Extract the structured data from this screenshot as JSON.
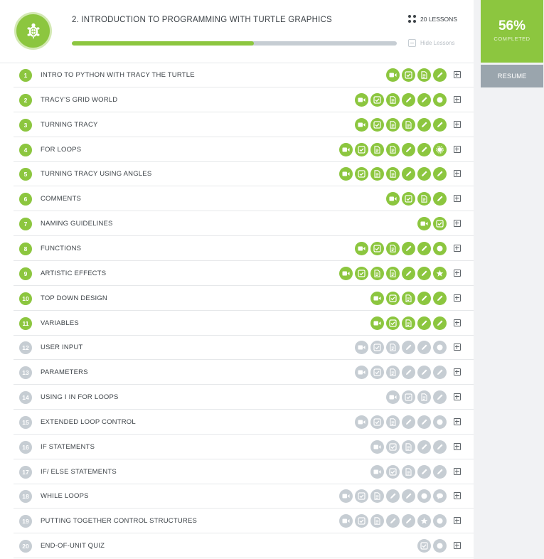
{
  "header": {
    "title": "2. INTRODUCTION TO PROGRAMMING WITH TURTLE GRAPHICS",
    "lessons_count": "20 LESSONS",
    "hide_lessons": "Hide Lessons",
    "progress_fraction": 0.56,
    "logo_icon": "turtle-icon"
  },
  "side": {
    "percent": "56%",
    "completed_label": "COMPLETED",
    "resume_label": "RESUME"
  },
  "colors": {
    "accent": "#8cc63f",
    "inactive": "#c6cdd3",
    "resume_bg": "#9aa5ad"
  },
  "lessons": [
    {
      "num": "1",
      "title": "INTRO TO PYTHON WITH TRACY THE TURTLE",
      "active": true,
      "activities": [
        "video",
        "check",
        "doc",
        "pencil"
      ]
    },
    {
      "num": "2",
      "title": "TRACY'S GRID WORLD",
      "active": true,
      "activities": [
        "video",
        "check",
        "doc",
        "pencil",
        "pencil",
        "dot"
      ]
    },
    {
      "num": "3",
      "title": "TURNING TRACY",
      "active": true,
      "activities": [
        "video",
        "check",
        "doc",
        "doc",
        "pencil",
        "pencil"
      ]
    },
    {
      "num": "4",
      "title": "FOR LOOPS",
      "active": true,
      "activities": [
        "video",
        "check",
        "doc",
        "doc",
        "pencil",
        "pencil",
        "gear"
      ]
    },
    {
      "num": "5",
      "title": "TURNING TRACY USING ANGLES",
      "active": true,
      "activities": [
        "video",
        "check",
        "doc",
        "doc",
        "pencil",
        "pencil",
        "pencil"
      ]
    },
    {
      "num": "6",
      "title": "COMMENTS",
      "active": true,
      "activities": [
        "video",
        "check",
        "doc",
        "pencil"
      ]
    },
    {
      "num": "7",
      "title": "NAMING GUIDELINES",
      "active": true,
      "activities": [
        "video",
        "check"
      ]
    },
    {
      "num": "8",
      "title": "FUNCTIONS",
      "active": true,
      "activities": [
        "video",
        "check",
        "doc",
        "pencil",
        "pencil",
        "dot"
      ]
    },
    {
      "num": "9",
      "title": "ARTISTIC EFFECTS",
      "active": true,
      "activities": [
        "video",
        "check",
        "doc",
        "doc",
        "pencil",
        "pencil",
        "star"
      ]
    },
    {
      "num": "10",
      "title": "TOP DOWN DESIGN",
      "active": true,
      "activities": [
        "video",
        "check",
        "doc",
        "pencil",
        "pencil"
      ]
    },
    {
      "num": "11",
      "title": "VARIABLES",
      "active": true,
      "activities": [
        "video",
        "check",
        "doc",
        "pencil",
        "pencil"
      ]
    },
    {
      "num": "12",
      "title": "USER INPUT",
      "active": false,
      "activities": [
        "video",
        "check",
        "doc",
        "pencil",
        "pencil",
        "dot"
      ]
    },
    {
      "num": "13",
      "title": "PARAMETERS",
      "active": false,
      "activities": [
        "video",
        "check",
        "doc",
        "pencil",
        "pencil",
        "pencil"
      ]
    },
    {
      "num": "14",
      "title": "USING I IN FOR LOOPS",
      "active": false,
      "activities": [
        "video",
        "check",
        "doc",
        "pencil"
      ]
    },
    {
      "num": "15",
      "title": "EXTENDED LOOP CONTROL",
      "active": false,
      "activities": [
        "video",
        "check",
        "doc",
        "pencil",
        "pencil",
        "dot"
      ]
    },
    {
      "num": "16",
      "title": "IF STATEMENTS",
      "active": false,
      "activities": [
        "video",
        "check",
        "doc",
        "pencil",
        "pencil"
      ]
    },
    {
      "num": "17",
      "title": "IF/ ELSE STATEMENTS",
      "active": false,
      "activities": [
        "video",
        "check",
        "doc",
        "pencil",
        "pencil"
      ]
    },
    {
      "num": "18",
      "title": "WHILE LOOPS",
      "active": false,
      "activities": [
        "video",
        "check",
        "doc",
        "pencil",
        "pencil",
        "dot",
        "chat"
      ]
    },
    {
      "num": "19",
      "title": "PUTTING TOGETHER CONTROL STRUCTURES",
      "active": false,
      "activities": [
        "video",
        "check",
        "doc",
        "pencil",
        "pencil",
        "star",
        "dot"
      ]
    },
    {
      "num": "20",
      "title": "END-OF-UNIT QUIZ",
      "active": false,
      "activities": [
        "check",
        "dot"
      ]
    }
  ]
}
